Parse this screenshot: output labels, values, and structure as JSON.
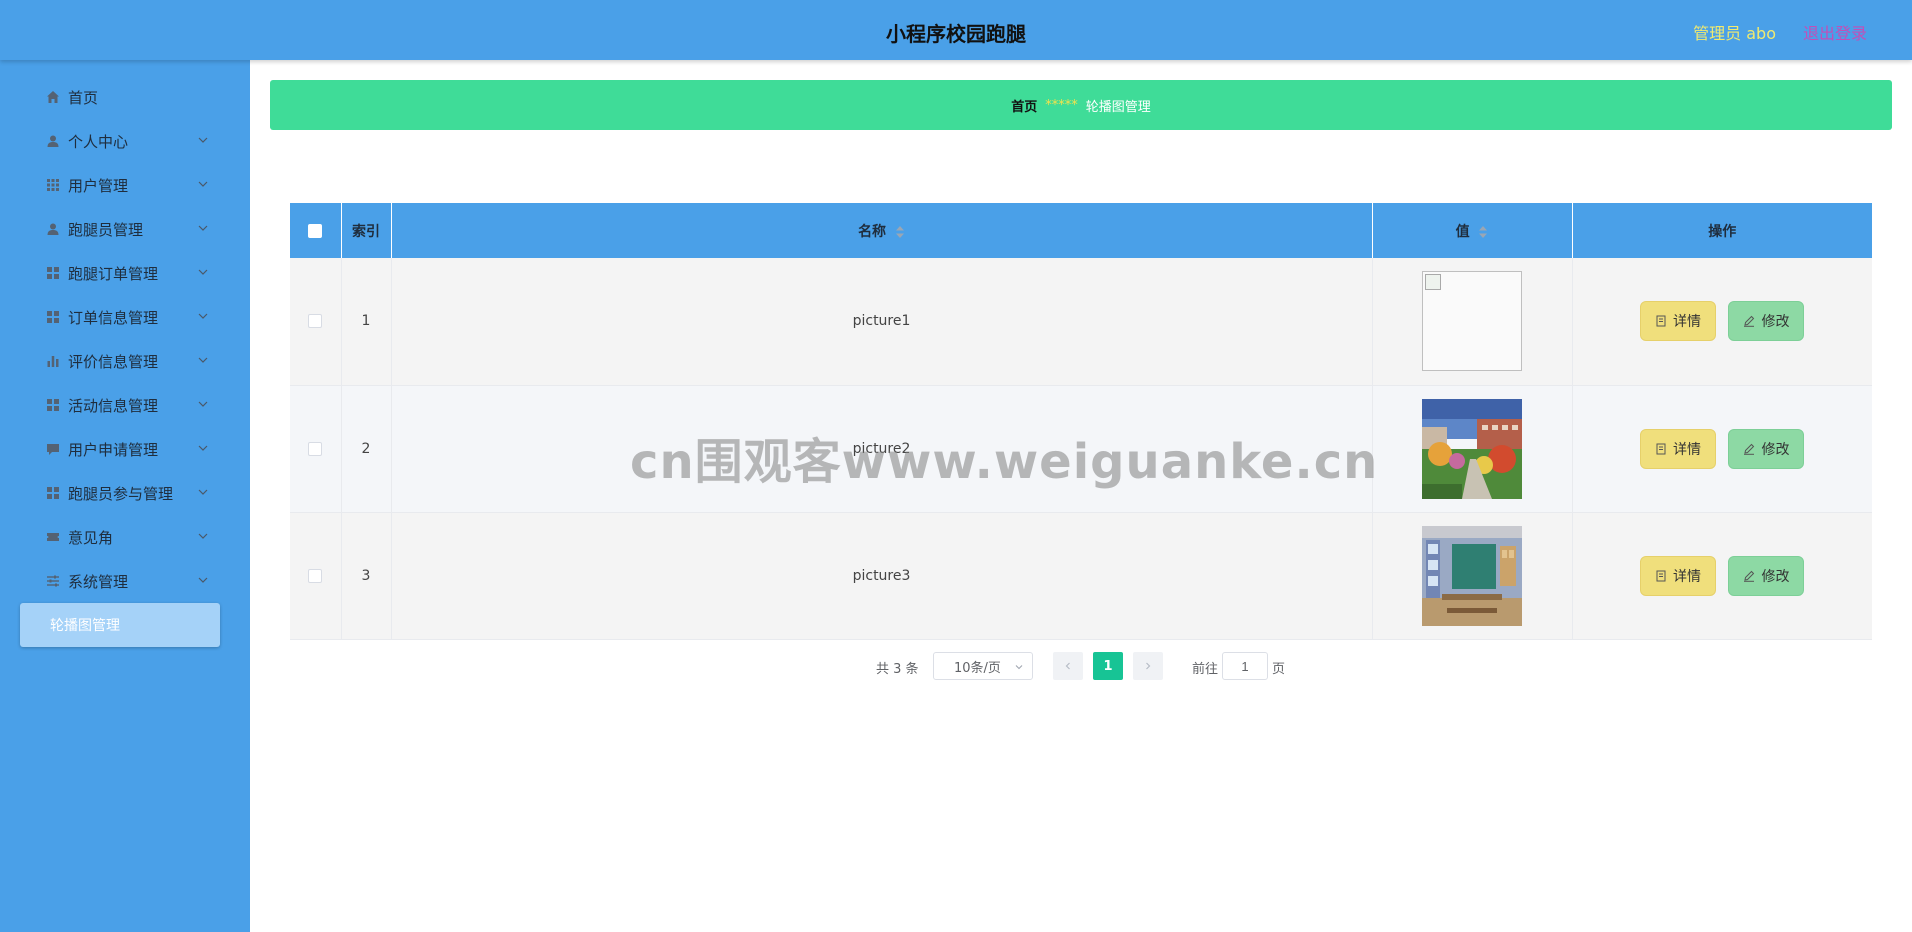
{
  "header": {
    "title": "小程序校园跑腿",
    "admin": "管理员 abo",
    "logout": "退出登录"
  },
  "sidebar": {
    "items": [
      {
        "label": "首页",
        "icon": "home-icon"
      },
      {
        "label": "个人中心",
        "icon": "user-icon"
      },
      {
        "label": "用户管理",
        "icon": "grid-icon"
      },
      {
        "label": "跑腿员管理",
        "icon": "user-icon"
      },
      {
        "label": "跑腿订单管理",
        "icon": "grid-icon"
      },
      {
        "label": "订单信息管理",
        "icon": "grid-icon"
      },
      {
        "label": "评价信息管理",
        "icon": "bar-chart-icon"
      },
      {
        "label": "活动信息管理",
        "icon": "grid-icon"
      },
      {
        "label": "用户申请管理",
        "icon": "chat-icon"
      },
      {
        "label": "跑腿员参与管理",
        "icon": "grid-icon"
      },
      {
        "label": "意见角",
        "icon": "ticket-icon"
      },
      {
        "label": "系统管理",
        "icon": "sliders-icon"
      }
    ],
    "active_sub": "轮播图管理"
  },
  "breadcrumb": {
    "home": "首页",
    "separator": "*****",
    "current": "轮播图管理"
  },
  "table": {
    "headers": {
      "index": "索引",
      "name": "名称",
      "value": "值",
      "actions": "操作"
    },
    "rows": [
      {
        "index": "1",
        "name": "picture1",
        "image": "broken-image"
      },
      {
        "index": "2",
        "name": "picture2",
        "image": "campus-garden-photo"
      },
      {
        "index": "3",
        "name": "picture3",
        "image": "classroom-photo"
      }
    ],
    "detail_label": "详情",
    "edit_label": "修改"
  },
  "pagination": {
    "total": "共 3 条",
    "page_size": "10条/页",
    "current_page": "1",
    "goto_label": "前往",
    "goto_value": "1",
    "page_suffix": "页"
  },
  "watermark": "cn围观客www.weiguanke.cn",
  "colors": {
    "header_bg": "#4aa0e8",
    "breadcrumb_bg": "#3fdc98",
    "admin_text": "#f1ea6f",
    "logout_text": "#c24fb8",
    "detail_btn": "#f0df7c",
    "edit_btn": "#8dd9a4",
    "page_active": "#17c495"
  }
}
